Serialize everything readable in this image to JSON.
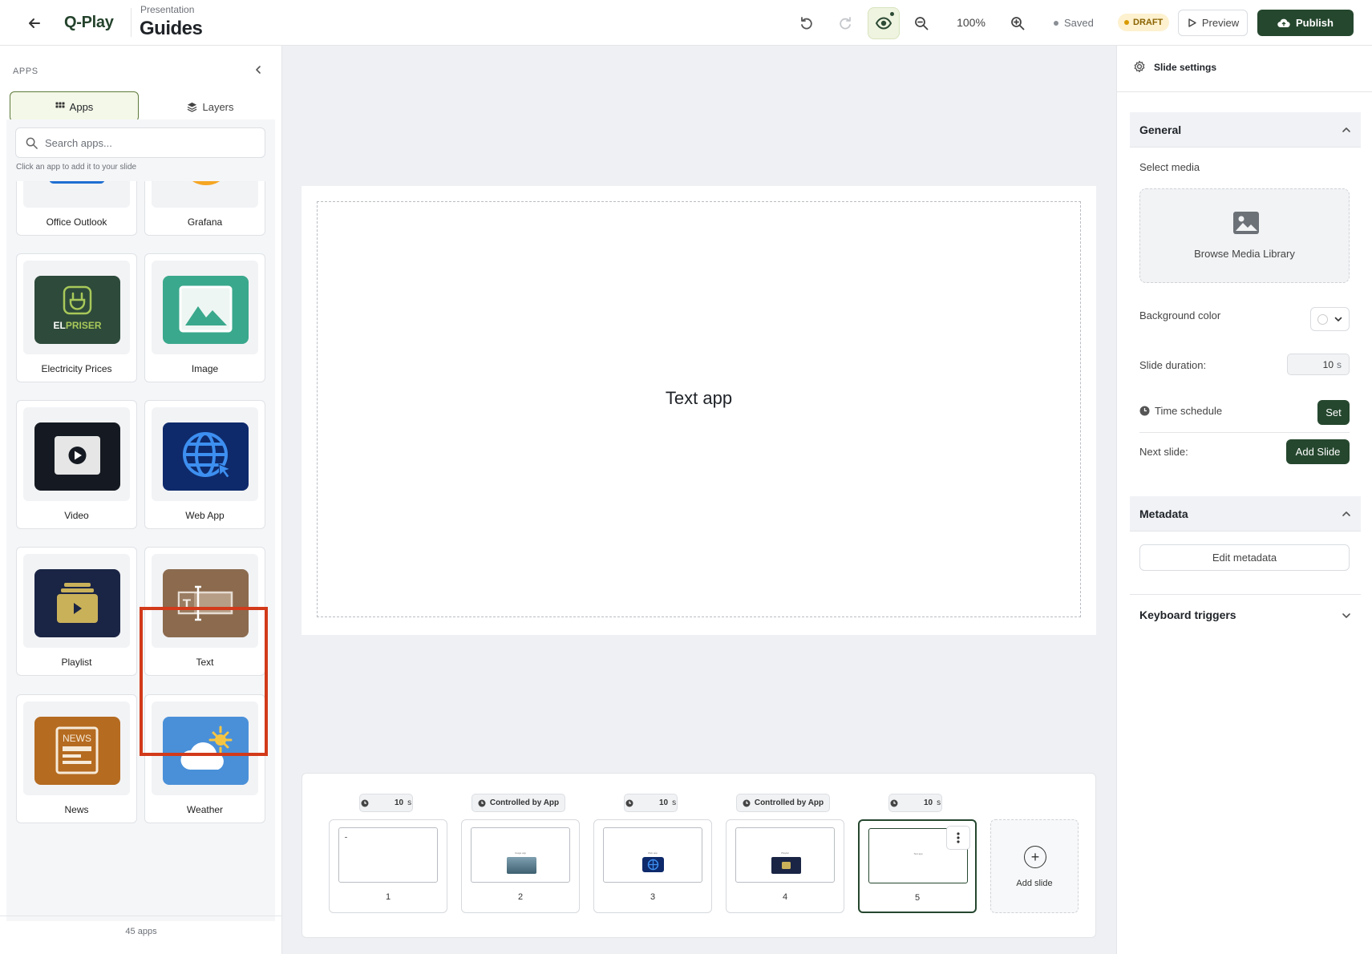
{
  "header": {
    "brand": "Q-Play",
    "breadcrumb": "Presentation",
    "title": "Guides",
    "zoom": "100%",
    "save_status": "Saved",
    "draft_badge": "DRAFT",
    "preview_label": "Preview",
    "publish_label": "Publish"
  },
  "sidebar": {
    "heading": "APPS",
    "tabs": [
      {
        "label": "Apps",
        "active": true
      },
      {
        "label": "Layers",
        "active": false
      }
    ],
    "search": {
      "placeholder": "Search apps...",
      "value": ""
    },
    "hint": "Click an app to add it to your slide",
    "apps": [
      {
        "label": "Office Outlook",
        "icon": "outlook-icon",
        "color": "#1f6fd1"
      },
      {
        "label": "Grafana",
        "icon": "grafana-icon",
        "color": "#f5a623"
      },
      {
        "label": "Electricity Prices",
        "icon": "elpriser-icon",
        "color": "#2d4a3a",
        "tile_text": "ELPRISER"
      },
      {
        "label": "Image",
        "icon": "image-icon",
        "color": "#3aa88c"
      },
      {
        "label": "Video",
        "icon": "video-icon",
        "color": "#151a22"
      },
      {
        "label": "Web App",
        "icon": "globe-icon",
        "color": "#0e2a6b"
      },
      {
        "label": "Playlist",
        "icon": "playlist-icon",
        "color": "#1a2444"
      },
      {
        "label": "Text",
        "icon": "text-icon",
        "color": "#8b6a4e",
        "highlighted": true
      },
      {
        "label": "News",
        "icon": "news-icon",
        "color": "#b56b20",
        "tile_text": "NEWS"
      },
      {
        "label": "Weather",
        "icon": "weather-icon",
        "color": "#4a90d9"
      },
      {
        "label": "",
        "icon": "shapes-icon",
        "color": "#f1e8dd"
      },
      {
        "label": "",
        "icon": "document-icon",
        "color": "#eef1f6"
      }
    ],
    "count": "45 apps"
  },
  "canvas": {
    "text": "Text app"
  },
  "timeline": {
    "slides": [
      {
        "number": "1",
        "duration": "10",
        "unit": "s",
        "preview": "text",
        "preview_color": "#ffffff"
      },
      {
        "number": "2",
        "duration": "Controlled by App",
        "unit": "",
        "preview": "image",
        "preview_color": "#4d7a8f"
      },
      {
        "number": "3",
        "duration": "10",
        "unit": "s",
        "preview": "webapp",
        "preview_color": "#0e2a6b"
      },
      {
        "number": "4",
        "duration": "Controlled by App",
        "unit": "",
        "preview": "playlist",
        "preview_color": "#1a2444"
      },
      {
        "number": "5",
        "duration": "10",
        "unit": "s",
        "preview": "text",
        "preview_color": "#ffffff",
        "selected": true
      }
    ],
    "add_slide_label": "Add slide"
  },
  "settings": {
    "title": "Slide settings",
    "general": {
      "title": "General",
      "select_media": "Select media",
      "browse_media": "Browse Media Library",
      "background_color_label": "Background color",
      "background_color": "#ffffff",
      "duration_label": "Slide duration:",
      "duration_value": "10",
      "duration_unit": "s",
      "time_schedule_label": "Time schedule",
      "set_label": "Set",
      "next_slide_label": "Next slide:",
      "add_slide_label": "Add Slide"
    },
    "metadata": {
      "title": "Metadata",
      "edit_label": "Edit metadata"
    },
    "keyboard": {
      "title": "Keyboard triggers"
    }
  },
  "colors": {
    "accent": "#25472e",
    "highlight": "#d23a1a",
    "draft": "#d89a00"
  }
}
